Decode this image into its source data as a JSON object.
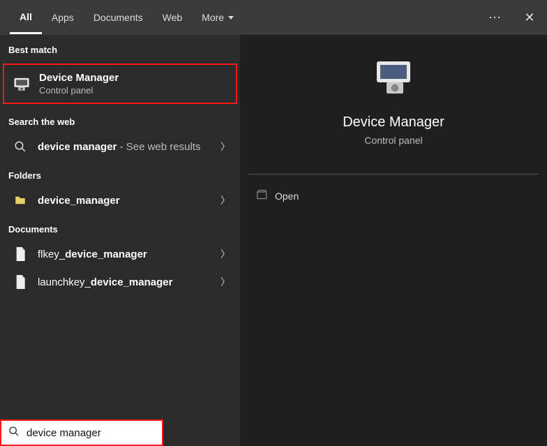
{
  "tabs": {
    "items": [
      {
        "label": "All",
        "active": true
      },
      {
        "label": "Apps",
        "active": false
      },
      {
        "label": "Documents",
        "active": false
      },
      {
        "label": "Web",
        "active": false
      }
    ],
    "more_label": "More"
  },
  "sections": {
    "best_match_label": "Best match",
    "search_web_label": "Search the web",
    "folders_label": "Folders",
    "documents_label": "Documents"
  },
  "best_match": {
    "title": "Device Manager",
    "subtitle": "Control panel"
  },
  "web_result": {
    "prefix": "device manager",
    "suffix": " - See web results"
  },
  "folders": [
    {
      "name_plain": "",
      "name_bold": "device_manager"
    }
  ],
  "documents": [
    {
      "name_plain": "flkey_",
      "name_bold": "device_manager"
    },
    {
      "name_plain": "launchkey_",
      "name_bold": "device_manager"
    }
  ],
  "preview": {
    "title": "Device Manager",
    "subtitle": "Control panel",
    "actions": [
      {
        "label": "Open"
      }
    ]
  },
  "search": {
    "value": "device manager"
  }
}
